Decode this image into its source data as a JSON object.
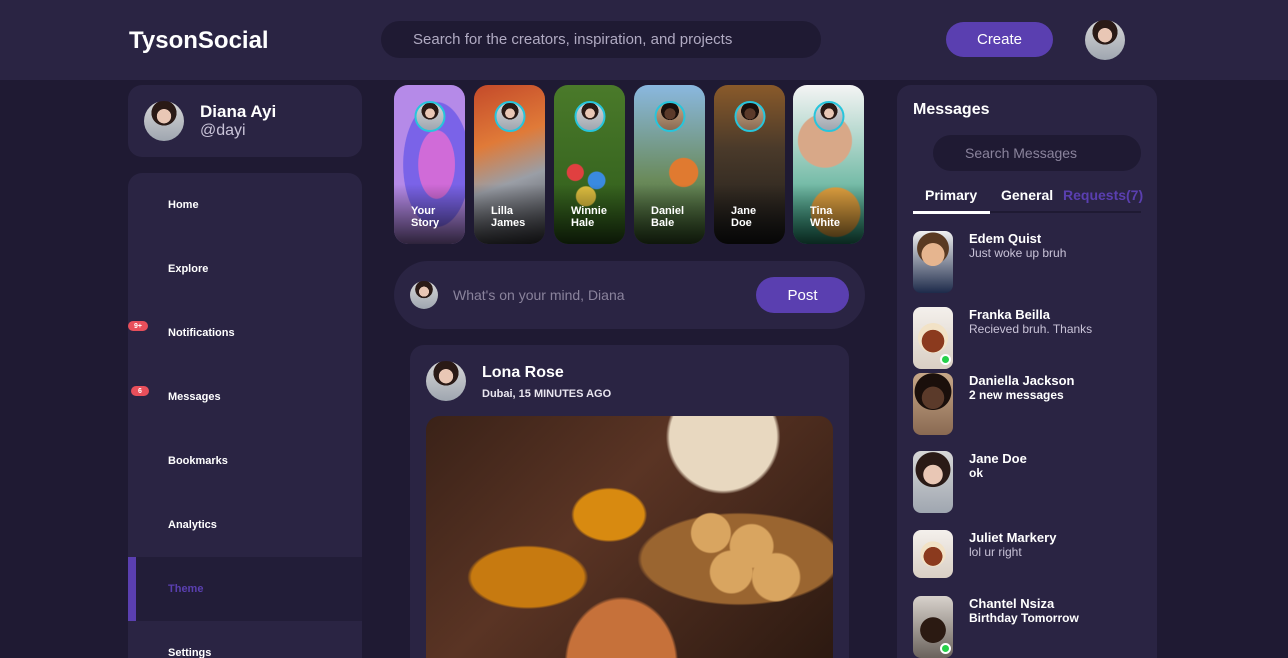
{
  "navbar": {
    "logo": "TysonSocial",
    "search_placeholder": "Search for the creators, inspiration, and projects",
    "create_label": "Create"
  },
  "profile": {
    "name": "Diana Ayi",
    "handle": "@dayi"
  },
  "menu": {
    "items": [
      {
        "label": "Home"
      },
      {
        "label": "Explore"
      },
      {
        "label": "Notifications",
        "badge": "9+"
      },
      {
        "label": "Messages",
        "badge": "6"
      },
      {
        "label": "Bookmarks"
      },
      {
        "label": "Analytics"
      },
      {
        "label": "Theme",
        "active": true
      },
      {
        "label": "Settings"
      }
    ]
  },
  "stories": [
    {
      "line1": "Your",
      "line2": "Story"
    },
    {
      "line1": "Lilla",
      "line2": "James"
    },
    {
      "line1": "Winnie",
      "line2": "Hale"
    },
    {
      "line1": "Daniel",
      "line2": "Bale"
    },
    {
      "line1": "Jane",
      "line2": "Doe"
    },
    {
      "line1": "Tina",
      "line2": "White"
    }
  ],
  "composer": {
    "placeholder": "What's on your mind, Diana",
    "post_label": "Post"
  },
  "feed": {
    "author": "Lona Rose",
    "meta": "Dubai, 15 MINUTES AGO"
  },
  "messages": {
    "title": "Messages",
    "search_placeholder": "Search Messages",
    "tabs": [
      "Primary",
      "General",
      "Requests(7)"
    ],
    "list": [
      {
        "name": "Edem Quist",
        "text": "Just woke up bruh",
        "bold": false,
        "online": false
      },
      {
        "name": "Franka Beilla",
        "text": "Recieved bruh. Thanks",
        "bold": false,
        "online": true
      },
      {
        "name": "Daniella Jackson",
        "text": "2 new messages",
        "bold": true,
        "online": false
      },
      {
        "name": "Jane Doe",
        "text": "ok",
        "bold": true,
        "online": false
      },
      {
        "name": "Juliet Markery",
        "text": "lol ur right",
        "bold": false,
        "online": false
      },
      {
        "name": "Chantel Nsiza",
        "text": "Birthday Tomorrow",
        "bold": true,
        "online": true
      }
    ]
  },
  "colors": {
    "background": "#1f1a33",
    "card": "#2a2443",
    "primary": "#5a3fb0",
    "story_ring": "#27c5dc",
    "badge": "#e84f5b",
    "online": "#27d04a"
  }
}
